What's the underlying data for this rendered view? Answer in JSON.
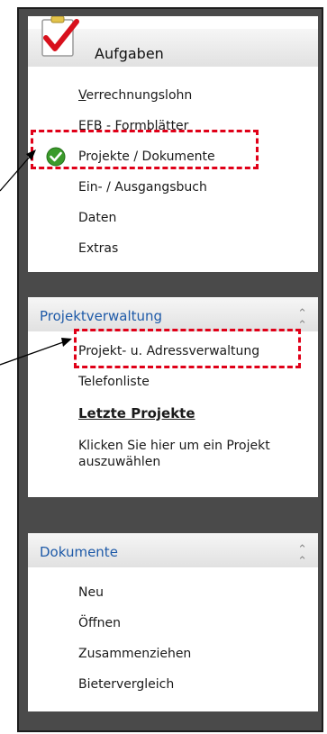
{
  "tasks": {
    "title": "Aufgaben",
    "items": [
      "Verrechnungslohn",
      "EFB - Formblätter",
      "Projekte / Dokumente",
      "Ein- / Ausgangsbuch",
      "Daten",
      "Extras"
    ]
  },
  "projektverwaltung": {
    "title": "Projektverwaltung",
    "items": [
      "Projekt- u. Adressverwaltung",
      "Telefonliste"
    ],
    "recent_heading": "Letzte Projekte",
    "hint": "Klicken Sie hier um ein Projekt auszuwählen"
  },
  "dokumente": {
    "title": "Dokumente",
    "items": [
      "Neu",
      "Öffnen",
      "Zusammenziehen",
      "Bietervergleich"
    ]
  },
  "colors": {
    "accent": "#1e5aa8",
    "highlight": "#e00018",
    "frame": "#4a4a4a"
  },
  "icons": [
    "checklist-icon",
    "check-circle-icon",
    "chevron-up-icon"
  ]
}
